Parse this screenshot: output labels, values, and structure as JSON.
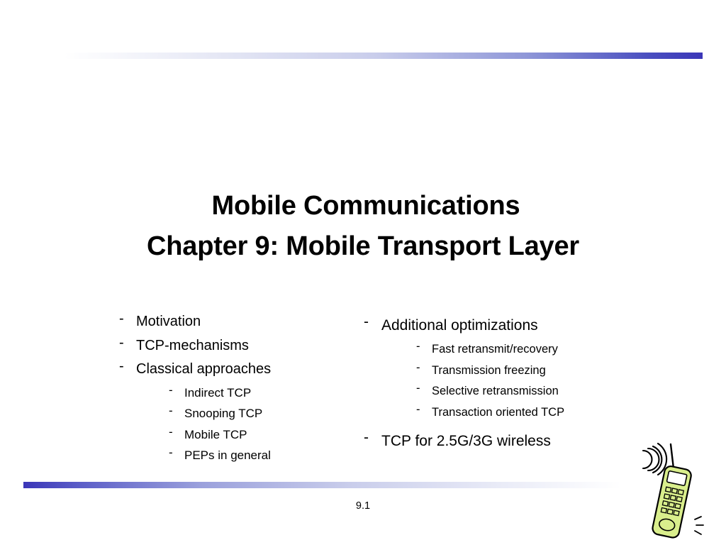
{
  "slide": {
    "title_lines": [
      "Mobile Communications",
      "Chapter 9: Mobile Transport Layer"
    ],
    "page_number": "9.1",
    "left_column": {
      "items": [
        {
          "label": "Motivation",
          "children": []
        },
        {
          "label": "TCP-mechanisms",
          "children": []
        },
        {
          "label": "Classical approaches",
          "children": [
            "Indirect TCP",
            "Snooping TCP",
            "Mobile TCP",
            "PEPs in general"
          ]
        }
      ]
    },
    "right_column": {
      "items": [
        {
          "label": "Additional optimizations",
          "children": [
            "Fast retransmit/recovery",
            "Transmission freezing",
            "Selective retransmission",
            "Transaction oriented TCP"
          ]
        },
        {
          "label": "TCP for 2.5G/3G wireless",
          "children": []
        }
      ]
    },
    "bullet_glyph": "-",
    "colors": {
      "accent_bar": "#3b36b8",
      "text": "#000000",
      "background": "#ffffff",
      "phone_body": "#d9ee8c"
    },
    "clipart_name": "mobile-phone-with-signal-waves"
  }
}
